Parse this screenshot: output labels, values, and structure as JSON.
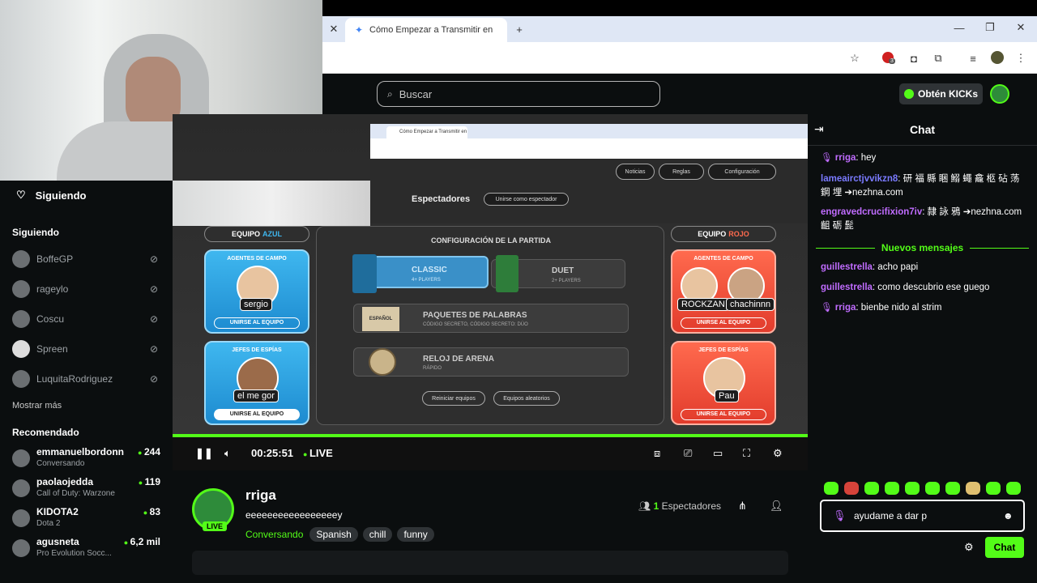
{
  "browser": {
    "tab_title": "Cómo Empezar a Transmitir en",
    "new_tab": "+",
    "close_tab": "✕",
    "window_min": "—",
    "window_max": "❐",
    "window_close": "✕",
    "extension_badge": "3"
  },
  "header": {
    "search_placeholder": "Buscar",
    "kicks_button": "Obtén KICKs"
  },
  "sidebar": {
    "following_header": "Siguiendo",
    "following_section": "Siguiendo",
    "following": [
      {
        "name": "BoffeGP"
      },
      {
        "name": "rageylo"
      },
      {
        "name": "Coscu"
      },
      {
        "name": "Spreen"
      },
      {
        "name": "LuquitaRodriguez"
      }
    ],
    "show_more": "Mostrar más",
    "recommended_section": "Recomendado",
    "recommended": [
      {
        "name": "emmanuelbordonn",
        "category": "Conversando",
        "viewers": "244"
      },
      {
        "name": "paolaojedda",
        "category": "Call of Duty: Warzone",
        "viewers": "119"
      },
      {
        "name": "KIDOTA2",
        "category": "Dota 2",
        "viewers": "83"
      },
      {
        "name": "agusneta",
        "category": "Pro Evolution Socc...",
        "viewers": "6,2 mil"
      }
    ]
  },
  "game": {
    "inner_tab_title": "Cómo Empezar a Transmitir en",
    "noticias": "Noticias",
    "reglas": "Reglas",
    "configuracion": "Configuración",
    "espectadores": "Espectadores",
    "unirse_espectador": "Unirse como espectador",
    "equipo_azul": "EQUIPO",
    "equipo_azul_color": "AZUL",
    "equipo_rojo": "EQUIPO",
    "equipo_rojo_color": "ROJO",
    "agentes_campo": "AGENTES DE CAMPO",
    "jefes_espias": "JEFES DE ESPÍAS",
    "unirse_equipo": "UNIRSE AL EQUIPO",
    "blue_agent": "sergio",
    "blue_spymaster": "el me gor",
    "red_agent_1": "ROCKZAN",
    "red_agent_2": "chachinnn",
    "red_spymaster": "Pau",
    "config_title": "CONFIGURACIÓN DE LA PARTIDA",
    "classic": "CLASSIC",
    "classic_players": "4+ PLAYERS",
    "duet": "DUET",
    "duet_players": "2+ PLAYERS",
    "paquetes": "PAQUETES DE PALABRAS",
    "paquetes_sub": "CÓDIGO SECRETO, CÓDIGO SECRETO: DÚO",
    "espanol": "ESPAÑOL",
    "reloj": "RELOJ DE ARENA",
    "reloj_sub": "RÁPIDO",
    "reiniciar": "Reiniciar equipos",
    "aleatorios": "Equipos aleatorios"
  },
  "player": {
    "time": "00:25:51",
    "live": "LIVE",
    "progress": 1.0
  },
  "stream": {
    "channel": "rriga",
    "title": "eeeeeeeeeeeeeeeeey",
    "category": "Conversando",
    "tags": [
      "Spanish",
      "chill",
      "funny"
    ],
    "viewer_count": "1",
    "viewer_label": "Espectadores",
    "live_badge": "LIVE"
  },
  "chat": {
    "title": "Chat",
    "new_messages": "Nuevos mensajes",
    "messages": [
      {
        "user": "rriga",
        "text": ": hey"
      },
      {
        "user": "lameairctjvvikzn8",
        "text": ": 研 福 縣 睏 鰯 蠅 龕 柩 砧 荡 鋼 埋 ➔nezhna.com"
      },
      {
        "user": "engravedcrucifixion7iv",
        "text": ": 隷 詠 鴉 ➔nezhna.com 齟 砺 髭"
      },
      {
        "user": "guillestrella",
        "text": ": acho papi"
      },
      {
        "user": "guillestrella",
        "text": ": como descubrio ese guego"
      },
      {
        "user": "rriga",
        "text": ": bienbe nido al strim"
      }
    ],
    "input_value": "ayudame a dar p",
    "send_button": "Chat",
    "accent": "#53fc18"
  }
}
